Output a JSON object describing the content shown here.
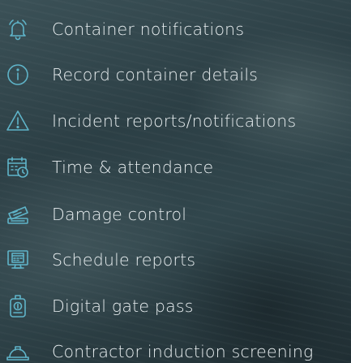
{
  "menu": {
    "items": [
      {
        "label": "Container notifications",
        "icon": "bell-icon"
      },
      {
        "label": "Record container details",
        "icon": "info-icon"
      },
      {
        "label": "Incident reports/notifications",
        "icon": "warning-icon"
      },
      {
        "label": "Time & attendance",
        "icon": "calendar-clock-icon"
      },
      {
        "label": "Damage control",
        "icon": "damage-report-icon"
      },
      {
        "label": "Schedule reports",
        "icon": "monitor-schedule-icon"
      },
      {
        "label": "Digital gate pass",
        "icon": "id-badge-icon"
      },
      {
        "label": "Contractor induction screening",
        "icon": "hard-hat-icon"
      }
    ]
  },
  "colors": {
    "icon": "#5fb4c9",
    "text": "#e8eef0",
    "background": "#2f4248"
  }
}
